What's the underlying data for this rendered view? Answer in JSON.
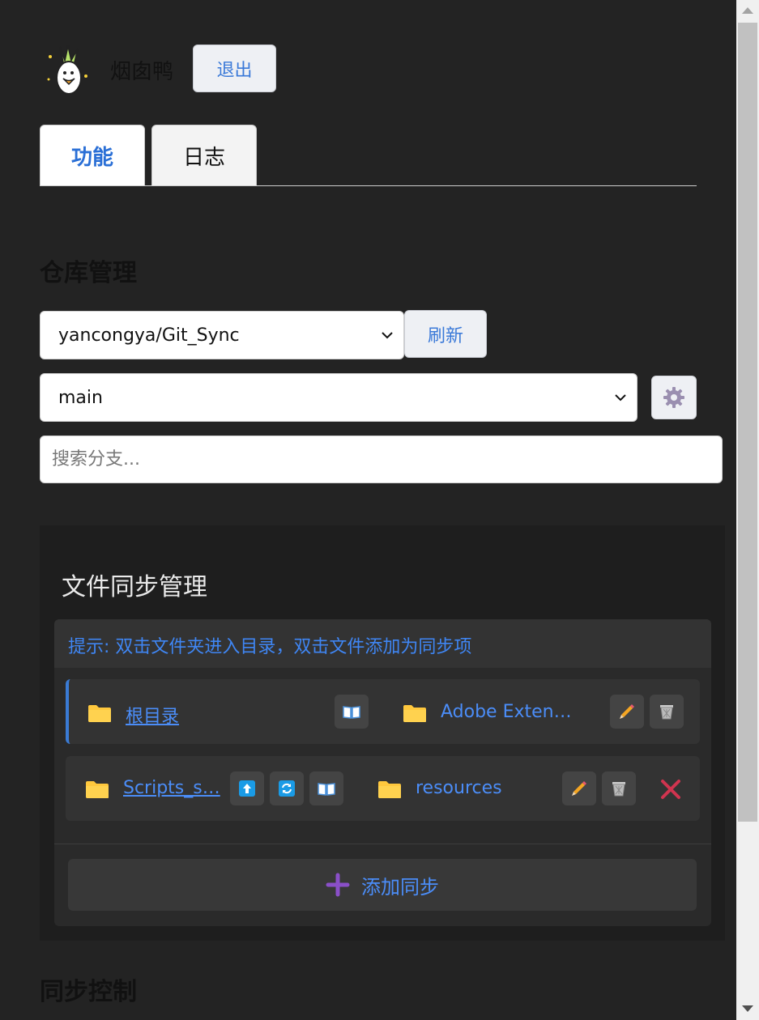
{
  "header": {
    "username": "烟囱鸭",
    "logout_label": "退出"
  },
  "tabs": [
    {
      "label": "功能",
      "active": true
    },
    {
      "label": "日志",
      "active": false
    }
  ],
  "repo_section": {
    "heading": "仓库管理",
    "repo_selected": "yancongya/Git_Sync",
    "refresh_label": "刷新",
    "branch_selected": "main",
    "search_placeholder": "搜索分支..."
  },
  "sync_panel": {
    "title": "文件同步管理",
    "tip": "提示: 双击文件夹进入目录，双击文件添加为同步项",
    "rows": [
      {
        "source": "根目录",
        "target": "Adobe Extend…"
      },
      {
        "source": "Scripts_s…",
        "target": "resources"
      }
    ],
    "add_label": "添加同步"
  },
  "sync_control": {
    "heading": "同步控制"
  },
  "colors": {
    "accent": "#3a79d8",
    "link": "#4b8df8",
    "folder": "#ffc83d",
    "delete": "#d0344f",
    "add_plus": "#8a4fc8"
  },
  "icons": [
    "duck-avatar",
    "chevron-down-icon",
    "gear-icon",
    "folder-icon",
    "book-icon",
    "pencil-icon",
    "trash-icon",
    "upload-icon",
    "refresh-icon",
    "close-icon",
    "plus-icon"
  ]
}
